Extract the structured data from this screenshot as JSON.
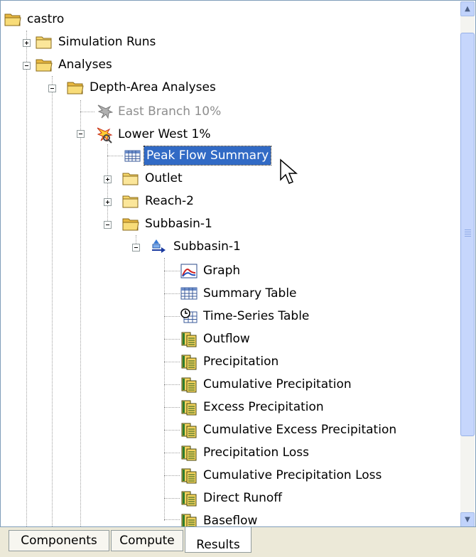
{
  "tree": {
    "items": [
      {
        "label": "castro",
        "icon": "folder-open-icon"
      },
      {
        "label": "Simulation Runs",
        "icon": "folder-icon"
      },
      {
        "label": "Analyses",
        "icon": "folder-open-icon"
      },
      {
        "label": "Depth-Area Analyses",
        "icon": "folder-open-icon"
      },
      {
        "label": "East Branch 10%",
        "icon": "analysis-disabled-icon"
      },
      {
        "label": "Lower West 1%",
        "icon": "analysis-icon"
      },
      {
        "label": "Peak Flow Summary",
        "icon": "table-icon"
      },
      {
        "label": "Outlet",
        "icon": "folder-icon"
      },
      {
        "label": "Reach-2",
        "icon": "folder-icon"
      },
      {
        "label": "Subbasin-1",
        "icon": "folder-open-icon"
      },
      {
        "label": "Subbasin-1",
        "icon": "subbasin-icon"
      },
      {
        "label": "Graph",
        "icon": "graph-icon"
      },
      {
        "label": "Summary Table",
        "icon": "table-icon"
      },
      {
        "label": "Time-Series Table",
        "icon": "time-series-table-icon"
      },
      {
        "label": "Outflow",
        "icon": "time-series-icon"
      },
      {
        "label": "Precipitation",
        "icon": "time-series-icon"
      },
      {
        "label": "Cumulative Precipitation",
        "icon": "time-series-icon"
      },
      {
        "label": "Excess Precipitation",
        "icon": "time-series-icon"
      },
      {
        "label": "Cumulative Excess Precipitation",
        "icon": "time-series-icon"
      },
      {
        "label": "Precipitation Loss",
        "icon": "time-series-icon"
      },
      {
        "label": "Cumulative Precipitation Loss",
        "icon": "time-series-icon"
      },
      {
        "label": "Direct Runoff",
        "icon": "time-series-icon"
      },
      {
        "label": "Baseflow",
        "icon": "time-series-icon"
      }
    ],
    "selected_item": "Peak Flow Summary"
  },
  "tabs": [
    {
      "label": "Components"
    },
    {
      "label": "Compute"
    },
    {
      "label": "Results",
      "active": true
    }
  ],
  "colors": {
    "selection": "#316ac5",
    "folder": "#f5d66b",
    "disabled_text": "#8e8e8e"
  }
}
